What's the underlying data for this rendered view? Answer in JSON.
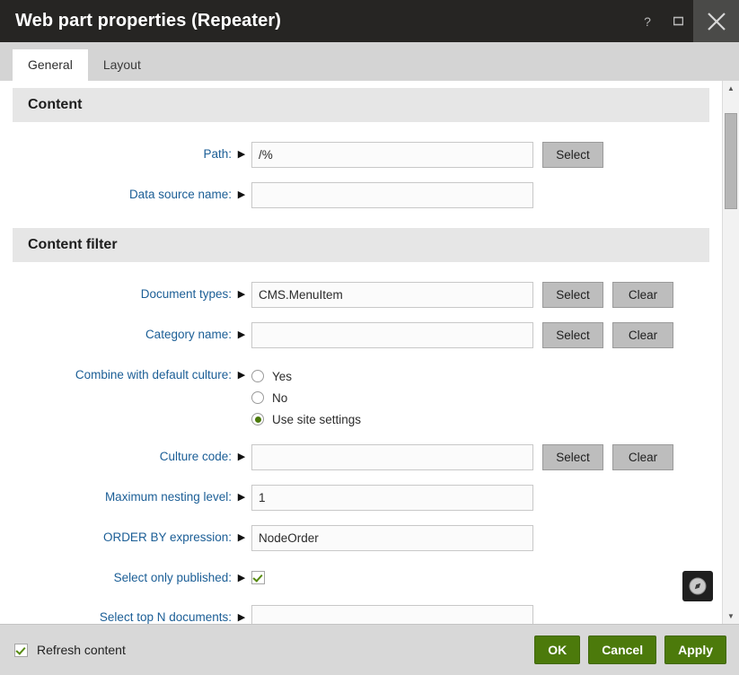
{
  "window": {
    "title": "Web part properties (Repeater)",
    "controls": {
      "help_label": "?",
      "maximize_label": "",
      "close_label": ""
    }
  },
  "tabs": [
    {
      "label": "General",
      "active": true
    },
    {
      "label": "Layout",
      "active": false
    }
  ],
  "sections": [
    {
      "title": "Content",
      "fields": [
        {
          "label": "Path:",
          "type": "text",
          "value": "/%",
          "placeholder": "",
          "buttons": [
            "Select"
          ]
        },
        {
          "label": "Data source name:",
          "type": "text",
          "value": "",
          "placeholder": "",
          "buttons": []
        }
      ]
    },
    {
      "title": "Content filter",
      "fields": [
        {
          "label": "Document types:",
          "type": "text",
          "value": "CMS.MenuItem",
          "placeholder": "",
          "buttons": [
            "Select",
            "Clear"
          ]
        },
        {
          "label": "Category name:",
          "type": "text",
          "value": "",
          "placeholder": "",
          "buttons": [
            "Select",
            "Clear"
          ]
        },
        {
          "label": "Combine with default culture:",
          "type": "radio",
          "options": [
            {
              "label": "Yes",
              "checked": false
            },
            {
              "label": "No",
              "checked": false
            },
            {
              "label": "Use site settings",
              "checked": true
            }
          ]
        },
        {
          "label": "Culture code:",
          "type": "text",
          "value": "",
          "placeholder": "",
          "buttons": [
            "Select",
            "Clear"
          ]
        },
        {
          "label": "Maximum nesting level:",
          "type": "text",
          "value": "1",
          "placeholder": "",
          "buttons": []
        },
        {
          "label": "ORDER BY expression:",
          "type": "text",
          "value": "NodeOrder",
          "placeholder": "",
          "buttons": []
        },
        {
          "label": "Select only published:",
          "type": "checkbox",
          "checked": true
        },
        {
          "label": "Select top N documents:",
          "type": "text",
          "value": "",
          "placeholder": "",
          "buttons": []
        }
      ]
    }
  ],
  "overlay": {
    "compass_icon": "compass-icon"
  },
  "scrollbar": {
    "up_arrow": "▲",
    "down_arrow": "▼"
  },
  "footer": {
    "refresh_checkbox_label": "Refresh content",
    "refresh_checked": true,
    "ok_label": "OK",
    "cancel_label": "Cancel",
    "apply_label": "Apply"
  },
  "colors": {
    "titlebar_bg": "#262523",
    "accent_green": "#4c7a0b",
    "label_blue": "#1b5e96",
    "section_header_bg": "#e6e6e6",
    "tabstrip_bg": "#d4d4d4",
    "footer_bg": "#d8d8d8",
    "gray_button_bg": "#bdbdbd"
  }
}
